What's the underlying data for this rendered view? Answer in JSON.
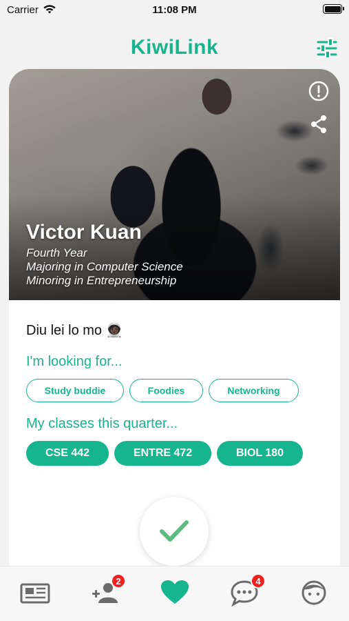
{
  "status_bar": {
    "carrier": "Carrier",
    "time": "11:08 PM"
  },
  "header": {
    "title": "KiwiLink"
  },
  "profile": {
    "name": "Victor Kuan",
    "year": "Fourth Year",
    "major": "Majoring in Computer Science",
    "minor": "Minoring in Entrepreneurship",
    "bio": "Diu lei lo mo 🧑🏿‍🚀"
  },
  "looking_for": {
    "title": "I'm looking for...",
    "tags": [
      "Study buddie",
      "Foodies",
      "Networking"
    ]
  },
  "classes": {
    "title": "My classes this quarter...",
    "items": [
      "CSE 442",
      "ENTRE 472",
      "BIOL 180"
    ]
  },
  "tab_bar": {
    "friend_requests_badge": "2",
    "messages_badge": "4"
  },
  "colors": {
    "accent": "#17b58e",
    "badge": "#f0201f",
    "check": "#5dbb7f"
  }
}
